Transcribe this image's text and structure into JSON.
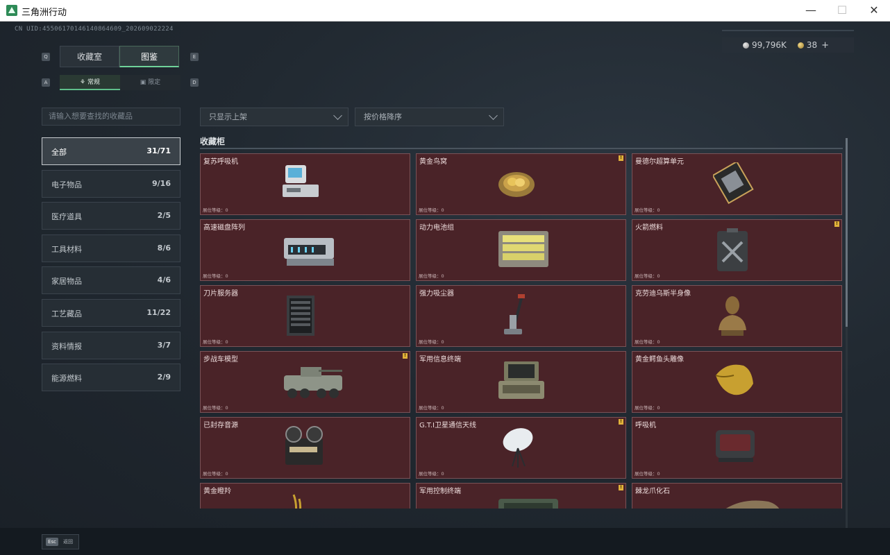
{
  "window": {
    "title": "三角洲行动",
    "minimize": "—",
    "maximize": "☐",
    "close": "✕"
  },
  "uid": "CN UID:4550617014614086460​9_20260902222​4",
  "currency": {
    "silver": "99,796K",
    "gold": "38",
    "plus": "+"
  },
  "keys": {
    "prev_tab": "Q",
    "next_tab": "E",
    "prev_sub": "A",
    "next_sub": "D"
  },
  "tabs": {
    "collection": "收藏室",
    "catalog": "图鉴"
  },
  "subtabs": {
    "normal": "常规",
    "limited": "限定"
  },
  "search": {
    "placeholder": "请输入想要查找的收藏品"
  },
  "filters": {
    "shelf": "只显示上架",
    "sort": "按价格降序"
  },
  "categories": [
    {
      "label": "全部",
      "count": "31/71"
    },
    {
      "label": "电子物品",
      "count": "9/16"
    },
    {
      "label": "医疗道具",
      "count": "2/5"
    },
    {
      "label": "工具材料",
      "count": "8/6"
    },
    {
      "label": "家居物品",
      "count": "4/6"
    },
    {
      "label": "工艺藏品",
      "count": "11/22"
    },
    {
      "label": "资料情报",
      "count": "3/7"
    },
    {
      "label": "能源燃料",
      "count": "2/9"
    }
  ],
  "section_title": "收藏柜",
  "level_label": "展位等级：0",
  "alert_mark": "!",
  "items": [
    {
      "name": "复苏呼吸机",
      "icon": "resuscitator-icon",
      "alert": false
    },
    {
      "name": "黄金鸟窝",
      "icon": "golden-nest-icon",
      "alert": true
    },
    {
      "name": "曼德尔超算单元",
      "icon": "supercomputer-unit-icon",
      "alert": false
    },
    {
      "name": "高速磁盘阵列",
      "icon": "disk-array-icon",
      "alert": false
    },
    {
      "name": "动力电池组",
      "icon": "battery-pack-icon",
      "alert": false
    },
    {
      "name": "火箭燃料",
      "icon": "rocket-fuel-icon",
      "alert": true
    },
    {
      "name": "刀片服务器",
      "icon": "blade-server-icon",
      "alert": false
    },
    {
      "name": "强力吸尘器",
      "icon": "vacuum-cleaner-icon",
      "alert": false
    },
    {
      "name": "克劳迪乌斯半身像",
      "icon": "bust-statue-icon",
      "alert": false
    },
    {
      "name": "步战车模型",
      "icon": "ifv-model-icon",
      "alert": true
    },
    {
      "name": "军用信息终端",
      "icon": "military-terminal-icon",
      "alert": false
    },
    {
      "name": "黄金鳄鱼头雕像",
      "icon": "golden-crocodile-icon",
      "alert": false
    },
    {
      "name": "已封存音源",
      "icon": "reel-recorder-icon",
      "alert": false
    },
    {
      "name": "G.T.I卫星通信天线",
      "icon": "satellite-dish-icon",
      "alert": true
    },
    {
      "name": "呼吸机",
      "icon": "ventilator-icon",
      "alert": false
    },
    {
      "name": "黄金瞪羚",
      "icon": "golden-gazelle-icon",
      "alert": false
    },
    {
      "name": "军用控制终端",
      "icon": "control-terminal-icon",
      "alert": true
    },
    {
      "name": "棘龙爪化石",
      "icon": "dino-claw-fossil-icon",
      "alert": false
    }
  ],
  "footer": {
    "esc_key": "Esc",
    "esc_label": "返回"
  }
}
